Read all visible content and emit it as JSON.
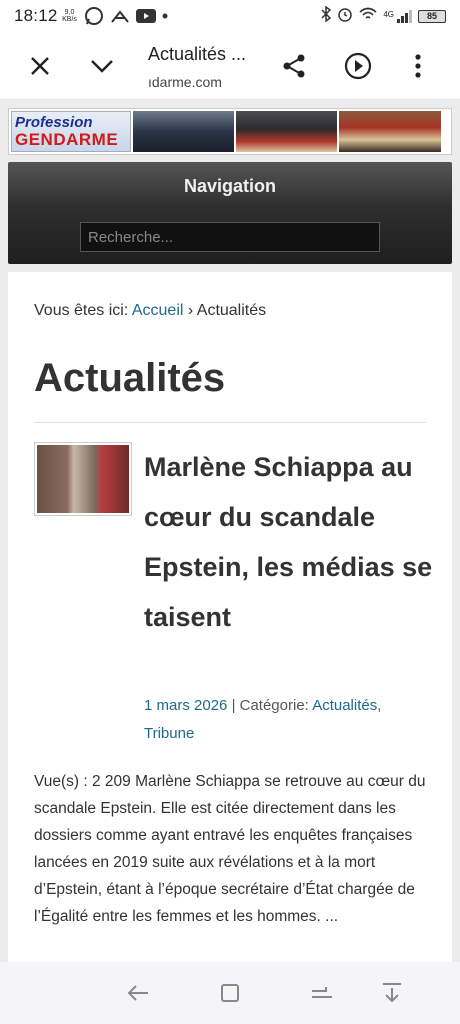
{
  "status": {
    "time": "18:12",
    "kb_top": "9,0",
    "kb_bottom": "KB/s",
    "network": "4G",
    "battery": "85"
  },
  "browser": {
    "title": "Actualités ...",
    "url": "ıdarme.com"
  },
  "banner": {
    "logo_line1": "Profession",
    "logo_line2": "GENDARME"
  },
  "nav": {
    "title": "Navigation",
    "search_placeholder": "Recherche..."
  },
  "breadcrumb": {
    "prefix": "Vous êtes ici:",
    "home": "Accueil",
    "separator": "›",
    "current": "Actualités"
  },
  "page_title": "Actualités",
  "article": {
    "title": "Marlène Schiappa au cœur du scandale Epstein, les médias se taisent",
    "date": "1 mars 2026",
    "meta_sep": "| Catégorie:",
    "category1": "Actualités",
    "category2": "Tribune",
    "excerpt": "Vue(s) : 2 209 Marlène Schiappa se retrouve au cœur du scandale Epstein. Elle est citée directement dans les dossiers comme ayant entravé les enquêtes françaises lancées en 2019 suite aux révélations et à la mort d’Epstein, étant à l’époque secrétaire d’État chargée de l’Égalité entre les femmes et les hommes. ..."
  },
  "icons": {
    "close": "close-icon",
    "dropdown": "chevron-down-icon",
    "share": "share-icon",
    "play": "play-icon",
    "menu": "more-vert-icon",
    "back": "back-icon",
    "home": "home-icon",
    "recents": "recents-icon",
    "hide": "hide-nav-icon"
  },
  "colors": {
    "link": "#1b6a8e",
    "logo_blue": "#1c2e8f",
    "logo_red": "#d11a1a"
  }
}
